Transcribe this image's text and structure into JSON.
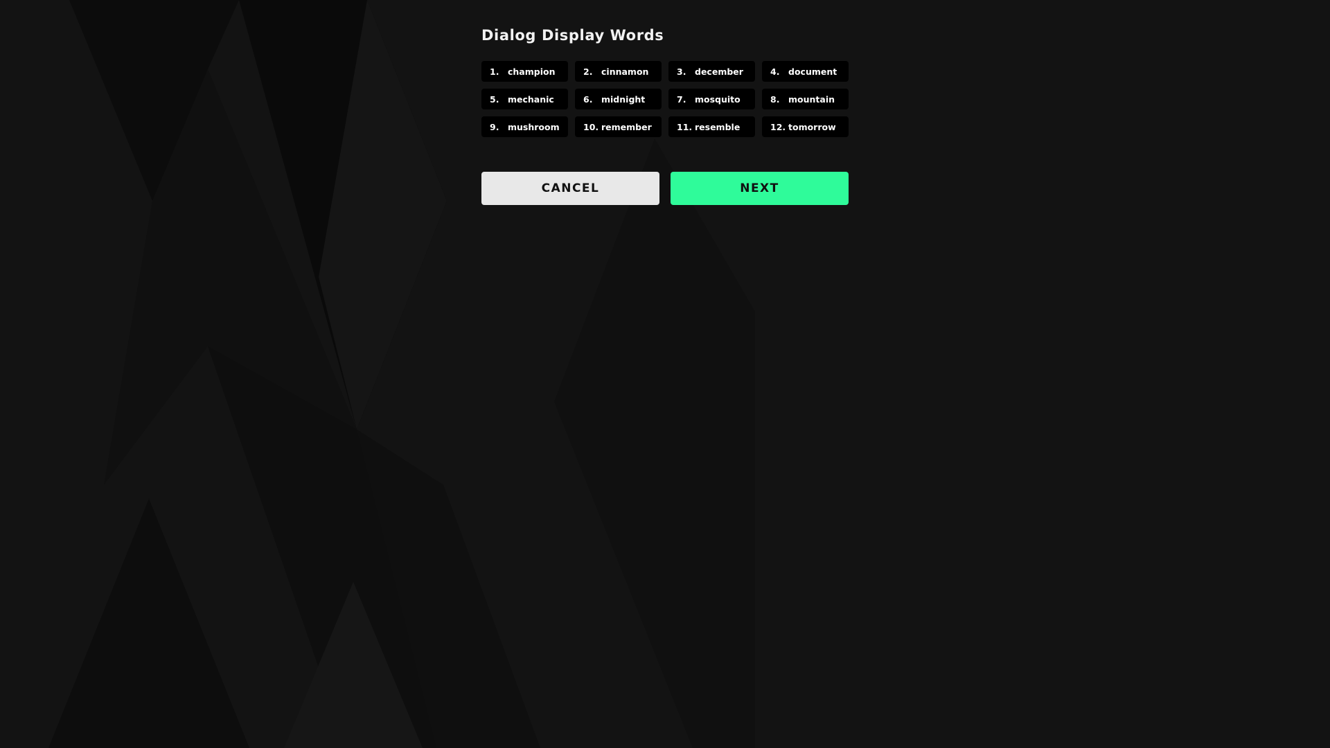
{
  "dialog": {
    "title": "Dialog Display Words",
    "words": [
      {
        "num": "1.",
        "word": "champion"
      },
      {
        "num": "2.",
        "word": "cinnamon"
      },
      {
        "num": "3.",
        "word": "december"
      },
      {
        "num": "4.",
        "word": "document"
      },
      {
        "num": "5.",
        "word": "mechanic"
      },
      {
        "num": "6.",
        "word": "midnight"
      },
      {
        "num": "7.",
        "word": "mosquito"
      },
      {
        "num": "8.",
        "word": "mountain"
      },
      {
        "num": "9.",
        "word": "mushroom"
      },
      {
        "num": "10.",
        "word": "remember"
      },
      {
        "num": "11.",
        "word": "resemble"
      },
      {
        "num": "12.",
        "word": "tomorrow"
      }
    ],
    "cancel_label": "CANCEL",
    "next_label": "NEXT"
  },
  "colors": {
    "background": "#131313",
    "chip_background": "#000000",
    "cancel_button": "#e8e8e8",
    "next_button": "#2ffb9a"
  }
}
